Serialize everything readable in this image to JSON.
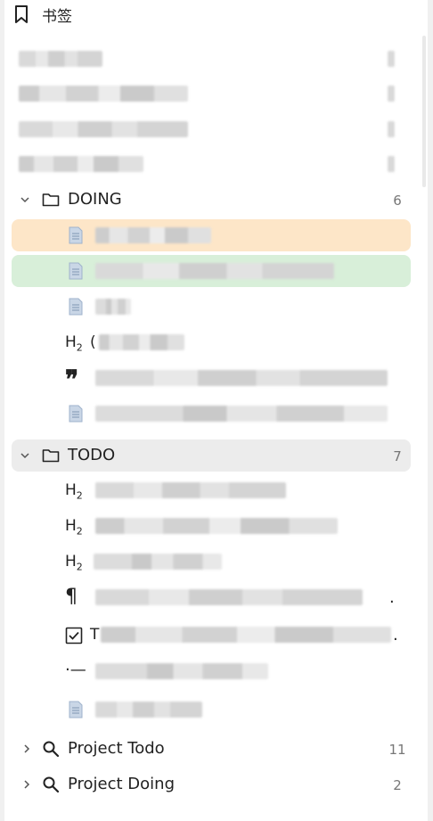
{
  "header": {
    "title": "书签",
    "icon": "bookmark-icon"
  },
  "groups": [
    {
      "name": "DOING",
      "count": "6"
    },
    {
      "name": "TODO",
      "count": "7"
    }
  ],
  "saved_searches": [
    {
      "name": "Project Todo",
      "count": "11"
    },
    {
      "name": "Project Doing",
      "count": "2"
    }
  ],
  "glyphs": {
    "h2": "H",
    "h2_sub": "2",
    "quote": "❞",
    "paragraph": "¶",
    "list": "⋅—",
    "heading_partial_char": "(",
    "todo_partial_char": "T",
    "para_trailing": ".",
    "task_trailing": "."
  },
  "colors": {
    "highlight_orange": "#fde6c8",
    "highlight_green": "#d8efd9",
    "selected_group": "#ececec",
    "count_text": "#777777"
  }
}
